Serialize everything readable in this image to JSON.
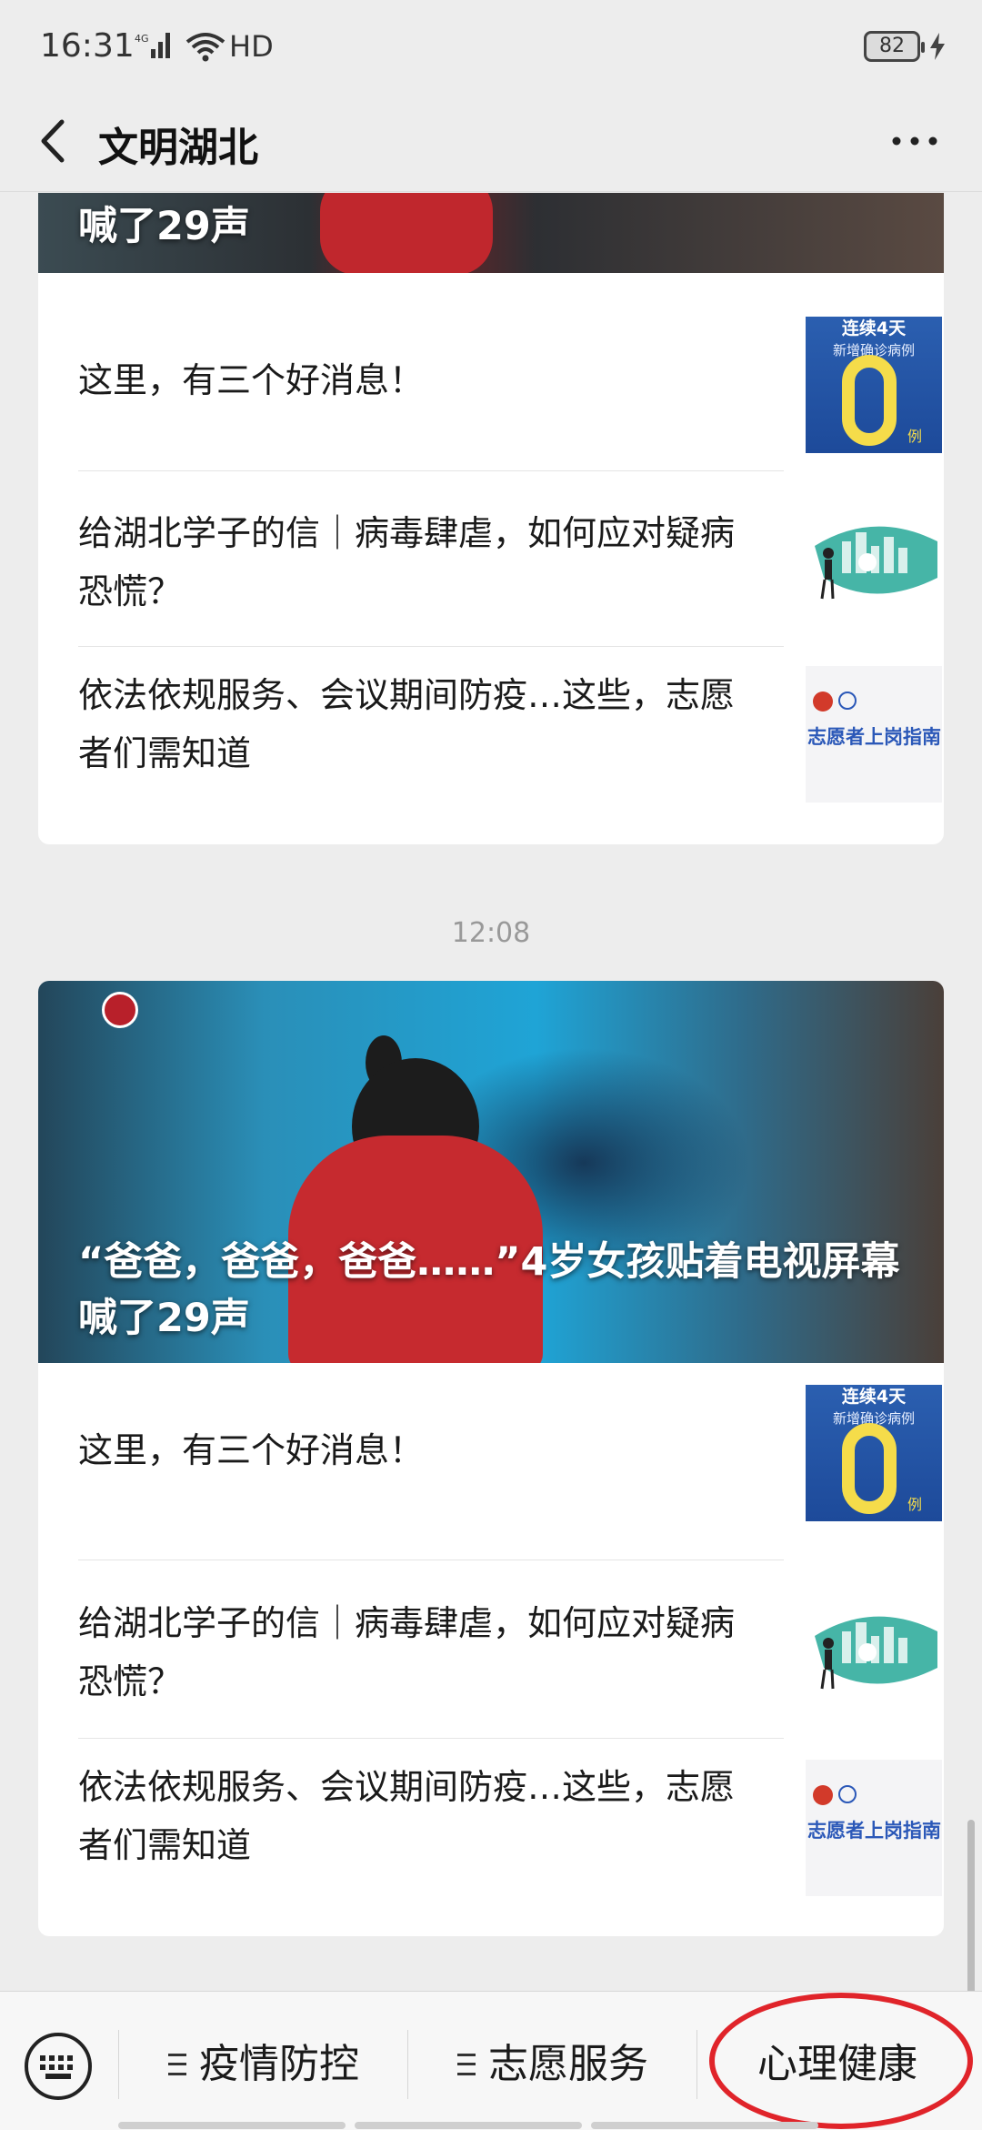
{
  "status_bar": {
    "time": "16:31",
    "network": "HD",
    "battery": "82"
  },
  "nav": {
    "title": "文明湖北"
  },
  "top_card": {
    "cut_headline": "喊了29声",
    "articles": [
      {
        "title": "这里，有三个好消息！",
        "thumb": "zero-cases-thumbnail"
      },
      {
        "title": "给湖北学子的信｜病毒肆虐，如何应对疑病恐慌？",
        "thumb": "mask-city-thumbnail"
      },
      {
        "title": "依法依规服务、会议期间防疫…这些，志愿者们需知道",
        "thumb": "volunteer-guide-thumbnail"
      }
    ]
  },
  "timestamp": "12:08",
  "second_card": {
    "headline": "“爸爸，爸爸，爸爸……”4岁女孩贴着电视屏幕喊了29声",
    "articles": [
      {
        "title": "这里，有三个好消息！",
        "thumb": "zero-cases-thumbnail"
      },
      {
        "title": "给湖北学子的信｜病毒肆虐，如何应对疑病恐慌？",
        "thumb": "mask-city-thumbnail"
      },
      {
        "title": "依法依规服务、会议期间防疫…这些，志愿者们需知道",
        "thumb": "volunteer-guide-thumbnail"
      }
    ]
  },
  "thumb_zero": {
    "line1": "连续4天",
    "line2": "新增确诊病例",
    "unit": "例"
  },
  "thumb_volunteer": {
    "title": "志愿者上岗指南"
  },
  "bottom_menu": {
    "items": [
      {
        "label": "疫情防控"
      },
      {
        "label": "志愿服务"
      },
      {
        "label": "心理健康"
      }
    ]
  },
  "colors": {
    "highlight_circle": "#e0242a",
    "accent_blue": "#2b58b8"
  }
}
